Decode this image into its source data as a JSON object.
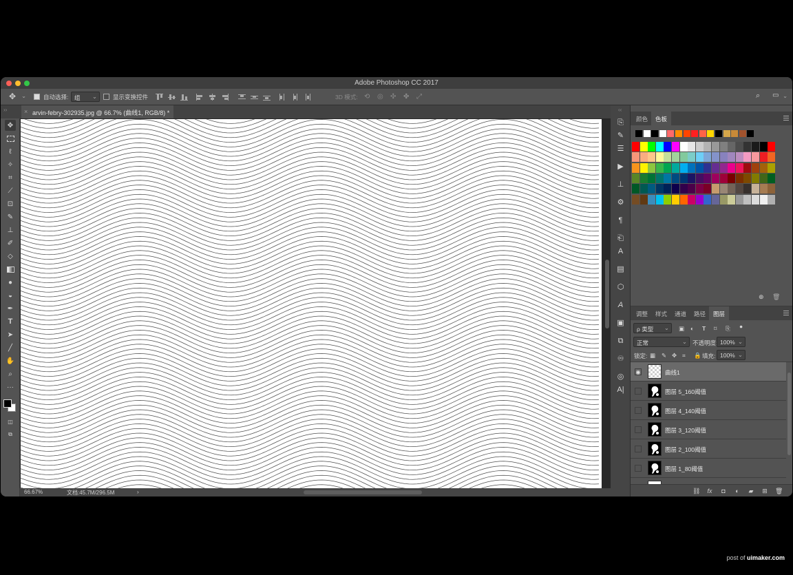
{
  "window": {
    "title": "Adobe Photoshop CC 2017"
  },
  "options_bar": {
    "auto_select_label": "自动选择:",
    "auto_select_value": "组",
    "show_transform_label": "显示变换控件",
    "mode_3d_label": "3D 模式:"
  },
  "document": {
    "tab_title": "arvin-febry-302935.jpg @ 66.7% (曲线1, RGB/8) *",
    "close_glyph": "×"
  },
  "status": {
    "zoom": "66.67%",
    "doc_size": "文档:45.7M/296.5M",
    "arrow": "›"
  },
  "swatches_panel": {
    "tabs": [
      "颜色",
      "色板"
    ],
    "active_tab": 1,
    "colors": [
      [
        "#000000",
        "#ffffff",
        "#000000",
        "#ffffff",
        "#ff6a6a",
        "#ff8c00",
        "#ff4500",
        "#ff2020",
        "#ff6347",
        "#ffd700",
        "#000000",
        "#d4a64a",
        "#c88a38",
        "#a0522d",
        "#000000"
      ],
      [
        "#ff0000",
        "#ffff00",
        "#00ff00",
        "#00ffff",
        "#0000ff",
        "#ff00ff",
        "#ffffff",
        "#e6e6e6",
        "#cccccc",
        "#b3b3b3",
        "#999999",
        "#808080",
        "#666666",
        "#4d4d4d",
        "#333333",
        "#1a1a1a",
        "#000000",
        "#ff0000"
      ],
      [
        "#f7977a",
        "#f9ad81",
        "#fdc68a",
        "#fff79a",
        "#c4df9b",
        "#a2d39c",
        "#82ca9d",
        "#7bcdc8",
        "#6ecff6",
        "#7ea7d8",
        "#8493ca",
        "#8882be",
        "#a187be",
        "#bc8dbf",
        "#f49ac2",
        "#f6989d",
        "#ee1d23",
        "#f26522"
      ],
      [
        "#f7941d",
        "#fff200",
        "#8dc63f",
        "#39b54a",
        "#00a651",
        "#00a99d",
        "#00aeef",
        "#0072bc",
        "#0054a6",
        "#2e3192",
        "#662d91",
        "#92278f",
        "#ec008c",
        "#ed145b",
        "#9e0b0f",
        "#a0410d",
        "#a3620a",
        "#aba000"
      ],
      [
        "#598527",
        "#197b30",
        "#007236",
        "#00746b",
        "#0076a3",
        "#004a80",
        "#003471",
        "#1b1464",
        "#440e62",
        "#630460",
        "#9e005d",
        "#9e0039",
        "#790000",
        "#7b2e00",
        "#7d4900",
        "#827b00",
        "#406618",
        "#005e20"
      ],
      [
        "#005826",
        "#005952",
        "#005b7f",
        "#003663",
        "#002157",
        "#0d004c",
        "#32004b",
        "#4b0049",
        "#7b0046",
        "#7a0026",
        "#c69c6d",
        "#998675",
        "#736357",
        "#534741",
        "#37302d",
        "#c7b299",
        "#a67c52",
        "#8c6239"
      ],
      [
        "#754c24",
        "#603913",
        "#3c8dbc",
        "#00c0ef",
        "#8fce00",
        "#ffcc00",
        "#ff6600",
        "#cc0066",
        "#9900cc",
        "#3366cc",
        "#666699",
        "#999966",
        "#cccc99",
        "#999999",
        "#c0c0c0",
        "#dcdcdc",
        "#f0f0f0",
        "#b0b0b0"
      ]
    ]
  },
  "layers_panel": {
    "tabs": [
      "调整",
      "样式",
      "通道",
      "路径",
      "图层"
    ],
    "active_tab": 4,
    "filter_label": "ρ 类型",
    "blend_mode": "正常",
    "opacity_label": "不透明度:",
    "opacity_value": "100%",
    "lock_label": "锁定:",
    "fill_label": "填充:",
    "fill_value": "100%",
    "layers": [
      {
        "name": "曲线1",
        "visible": true,
        "selected": true,
        "thumb": "transparent"
      },
      {
        "name": "图层 5_160阈值",
        "visible": false,
        "selected": false,
        "thumb": "bw"
      },
      {
        "name": "图层 4_140阈值",
        "visible": false,
        "selected": false,
        "thumb": "bw"
      },
      {
        "name": "图层 3_120阈值",
        "visible": false,
        "selected": false,
        "thumb": "bw"
      },
      {
        "name": "图层 2_100阈值",
        "visible": false,
        "selected": false,
        "thumb": "bw"
      },
      {
        "name": "图层 1_80阈值",
        "visible": false,
        "selected": false,
        "thumb": "bw"
      }
    ],
    "footer_icons": [
      "link-icon",
      "fx-icon",
      "mask-icon",
      "adjustment-icon",
      "folder-icon",
      "new-layer-icon",
      "trash-icon"
    ]
  },
  "watermark": {
    "prefix": "post of ",
    "site": "uimaker.com"
  },
  "accent": {
    "traffic_red": "#fc5f57",
    "traffic_yellow": "#fdbc2e",
    "traffic_green": "#33c748"
  }
}
